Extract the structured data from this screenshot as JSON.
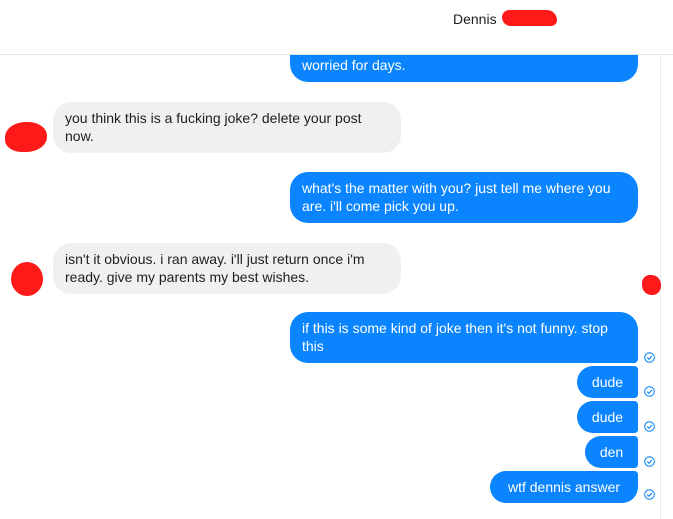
{
  "header": {
    "contact_name": "Dennis"
  },
  "messages": [
    {
      "id": "m1",
      "side": "out",
      "text": "worried for days."
    },
    {
      "id": "m2",
      "side": "in",
      "text": "you think this is a fucking joke? delete your post now."
    },
    {
      "id": "m3",
      "side": "out",
      "text": "what's the matter with you? just tell me where you are. i'll come pick you up."
    },
    {
      "id": "m4",
      "side": "in",
      "text": "isn't it obvious. i ran away. i'll just return once i'm ready. give my parents my best wishes."
    },
    {
      "id": "m5",
      "side": "out",
      "text": "if this is some kind of joke then it's not funny. stop this"
    },
    {
      "id": "m6",
      "side": "out",
      "text": "dude"
    },
    {
      "id": "m7",
      "side": "out",
      "text": "dude"
    },
    {
      "id": "m8",
      "side": "out",
      "text": "den"
    },
    {
      "id": "m9",
      "side": "out",
      "text": "wtf dennis answer"
    }
  ],
  "icons": {
    "seen": "check-circle-icon",
    "avatar": "avatar-redacted"
  },
  "colors": {
    "outgoing": "#0a84ff",
    "incoming": "#f0f0f0",
    "redaction": "#ff1a1a"
  }
}
